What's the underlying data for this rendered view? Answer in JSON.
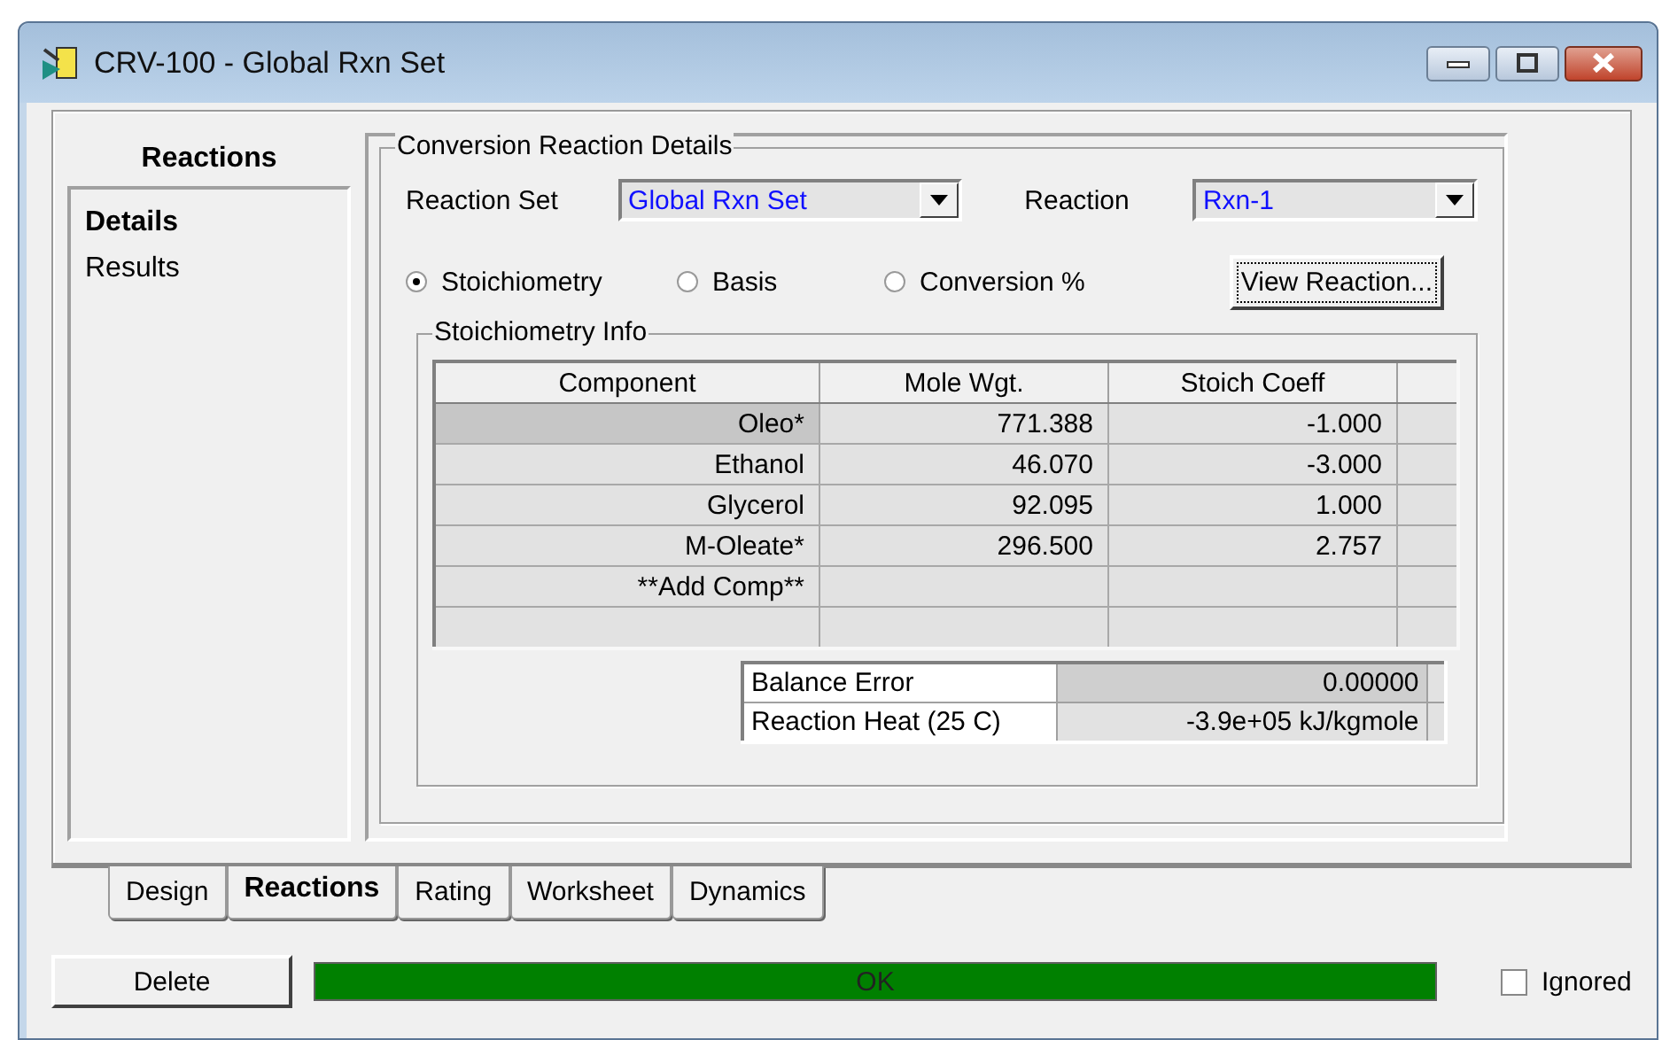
{
  "window": {
    "title": "CRV-100 - Global Rxn Set"
  },
  "sidebar": {
    "title": "Reactions",
    "items": [
      {
        "label": "Details",
        "selected": true
      },
      {
        "label": "Results",
        "selected": false
      }
    ]
  },
  "details": {
    "title": "Conversion Reaction Details",
    "reaction_set": {
      "label": "Reaction Set",
      "value": "Global Rxn Set"
    },
    "reaction": {
      "label": "Reaction",
      "value": "Rxn-1"
    },
    "options": [
      {
        "label": "Stoichiometry",
        "selected": true
      },
      {
        "label": "Basis",
        "selected": false
      },
      {
        "label": "Conversion %",
        "selected": false
      }
    ],
    "view_button": "View Reaction...",
    "stoich": {
      "title": "Stoichiometry Info",
      "columns": [
        "Component",
        "Mole Wgt.",
        "Stoich Coeff"
      ],
      "rows": [
        {
          "cells": [
            "Oleo*",
            "771.388",
            "-1.000"
          ],
          "selected": true
        },
        {
          "cells": [
            "Ethanol",
            "46.070",
            "-3.000"
          ],
          "selected": false
        },
        {
          "cells": [
            "Glycerol",
            "92.095",
            "1.000"
          ],
          "selected": false
        },
        {
          "cells": [
            "M-Oleate*",
            "296.500",
            "2.757"
          ],
          "selected": false
        },
        {
          "cells": [
            "**Add Comp**"
          ],
          "selected": false
        }
      ],
      "summary": [
        {
          "label": "Balance Error",
          "value": "0.00000"
        },
        {
          "label": "Reaction Heat (25 C)",
          "value": "-3.9e+05 kJ/kgmole"
        }
      ]
    }
  },
  "tabs": [
    {
      "label": "Design",
      "selected": false
    },
    {
      "label": "Reactions",
      "selected": true
    },
    {
      "label": "Rating",
      "selected": false
    },
    {
      "label": "Worksheet",
      "selected": false
    },
    {
      "label": "Dynamics",
      "selected": false
    }
  ],
  "footer": {
    "delete_button": "Delete",
    "status": "OK",
    "ignored": {
      "label": "Ignored",
      "checked": false
    }
  }
}
